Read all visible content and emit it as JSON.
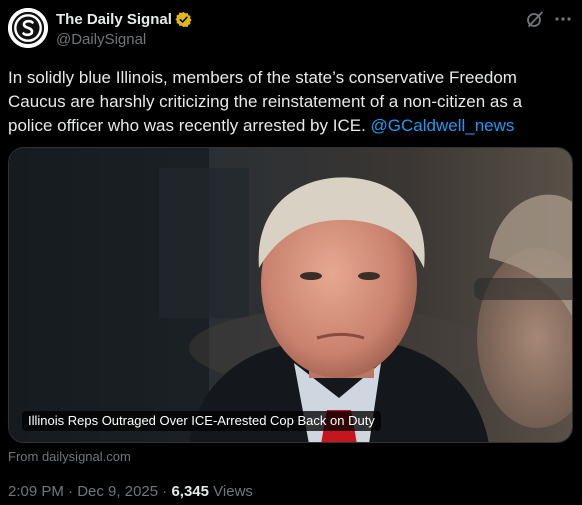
{
  "account": {
    "display_name": "The Daily Signal",
    "handle": "@DailySignal",
    "avatar_icon": "daily-signal-logo",
    "verified_badge": "gold-verified-badge",
    "badge_color": "#e2b719"
  },
  "header_icons": {
    "grok": "grok-icon",
    "more": "more-icon"
  },
  "tweet": {
    "text": "In solidly blue Illinois, members of the state’s conservative Freedom Caucus are harshly criticizing the reinstatement of a non-citizen as a police officer who was recently arrested by ICE. ",
    "mention": "@GCaldwell_news",
    "mention_color": "#1d9bf0"
  },
  "card": {
    "caption": "Illinois Reps Outraged Over ICE-Arrested Cop Back on Duty",
    "source": "From dailysignal.com"
  },
  "meta": {
    "time": "2:09 PM",
    "sep1": " · ",
    "date": "Dec 9, 2025",
    "sep2": " · ",
    "views_count": "6,345",
    "views_label": " Views"
  },
  "colors": {
    "background": "#000000",
    "text_primary": "#e7e9ea",
    "text_secondary": "#71767b"
  }
}
